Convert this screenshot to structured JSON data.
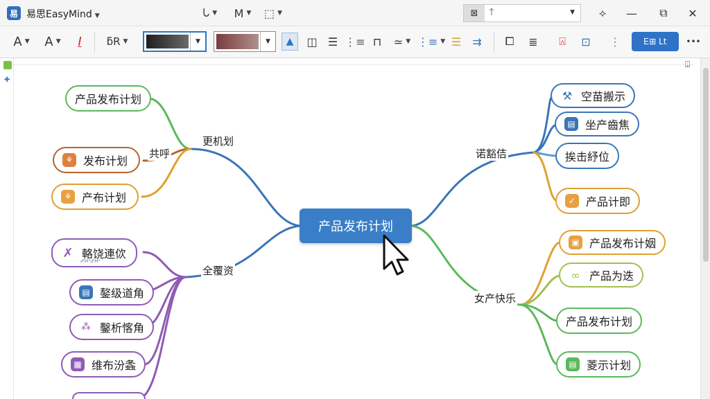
{
  "app": {
    "title": "易思EasyMind",
    "logo": "易"
  },
  "titlebar": {
    "tools": [
      "ᘂ",
      "M",
      "⬚"
    ],
    "search_icon": "image-icon",
    "search_value": "↑"
  },
  "toolbar": {
    "font_a": "A",
    "font_b": "A",
    "italic": "I",
    "brush_label": "ƃR",
    "action_label": "Ꭼ⊞ Lt",
    "more": "•••"
  },
  "colors": {
    "accent": "#2f73c9",
    "center": "#3a7ec8",
    "green": "#5cb85c",
    "orange": "#e0a030",
    "brown": "#b8632e",
    "purple": "#8e5bb5",
    "blue": "#3a75b8",
    "lightblue": "#5b9bd5"
  },
  "mindmap": {
    "center": "产品发布计划",
    "branches": {
      "b1": "更机划",
      "b1_sub": "共呼",
      "b2": "全覆资",
      "b3": "诺豁佶",
      "b4": "女产快乐"
    },
    "nodes": {
      "n1": "产品发布计划",
      "n2": "发布计划",
      "n3": "产布计划",
      "n4": "輅饶連佽",
      "n5": "鏊级道角",
      "n6": "鑿析愘角",
      "n7": "维布汾螽",
      "n8": "空苗搬示",
      "n9": "坐产齒焦",
      "n10": "挨击紓位",
      "n11": "产品计即",
      "n12": "产品发布计姻",
      "n13": "产品为迭",
      "n14": "产品发布计划",
      "n15": "菱示计划"
    },
    "n4_subtext": "ᕷᕼᕽᕷᕼᕽ"
  }
}
